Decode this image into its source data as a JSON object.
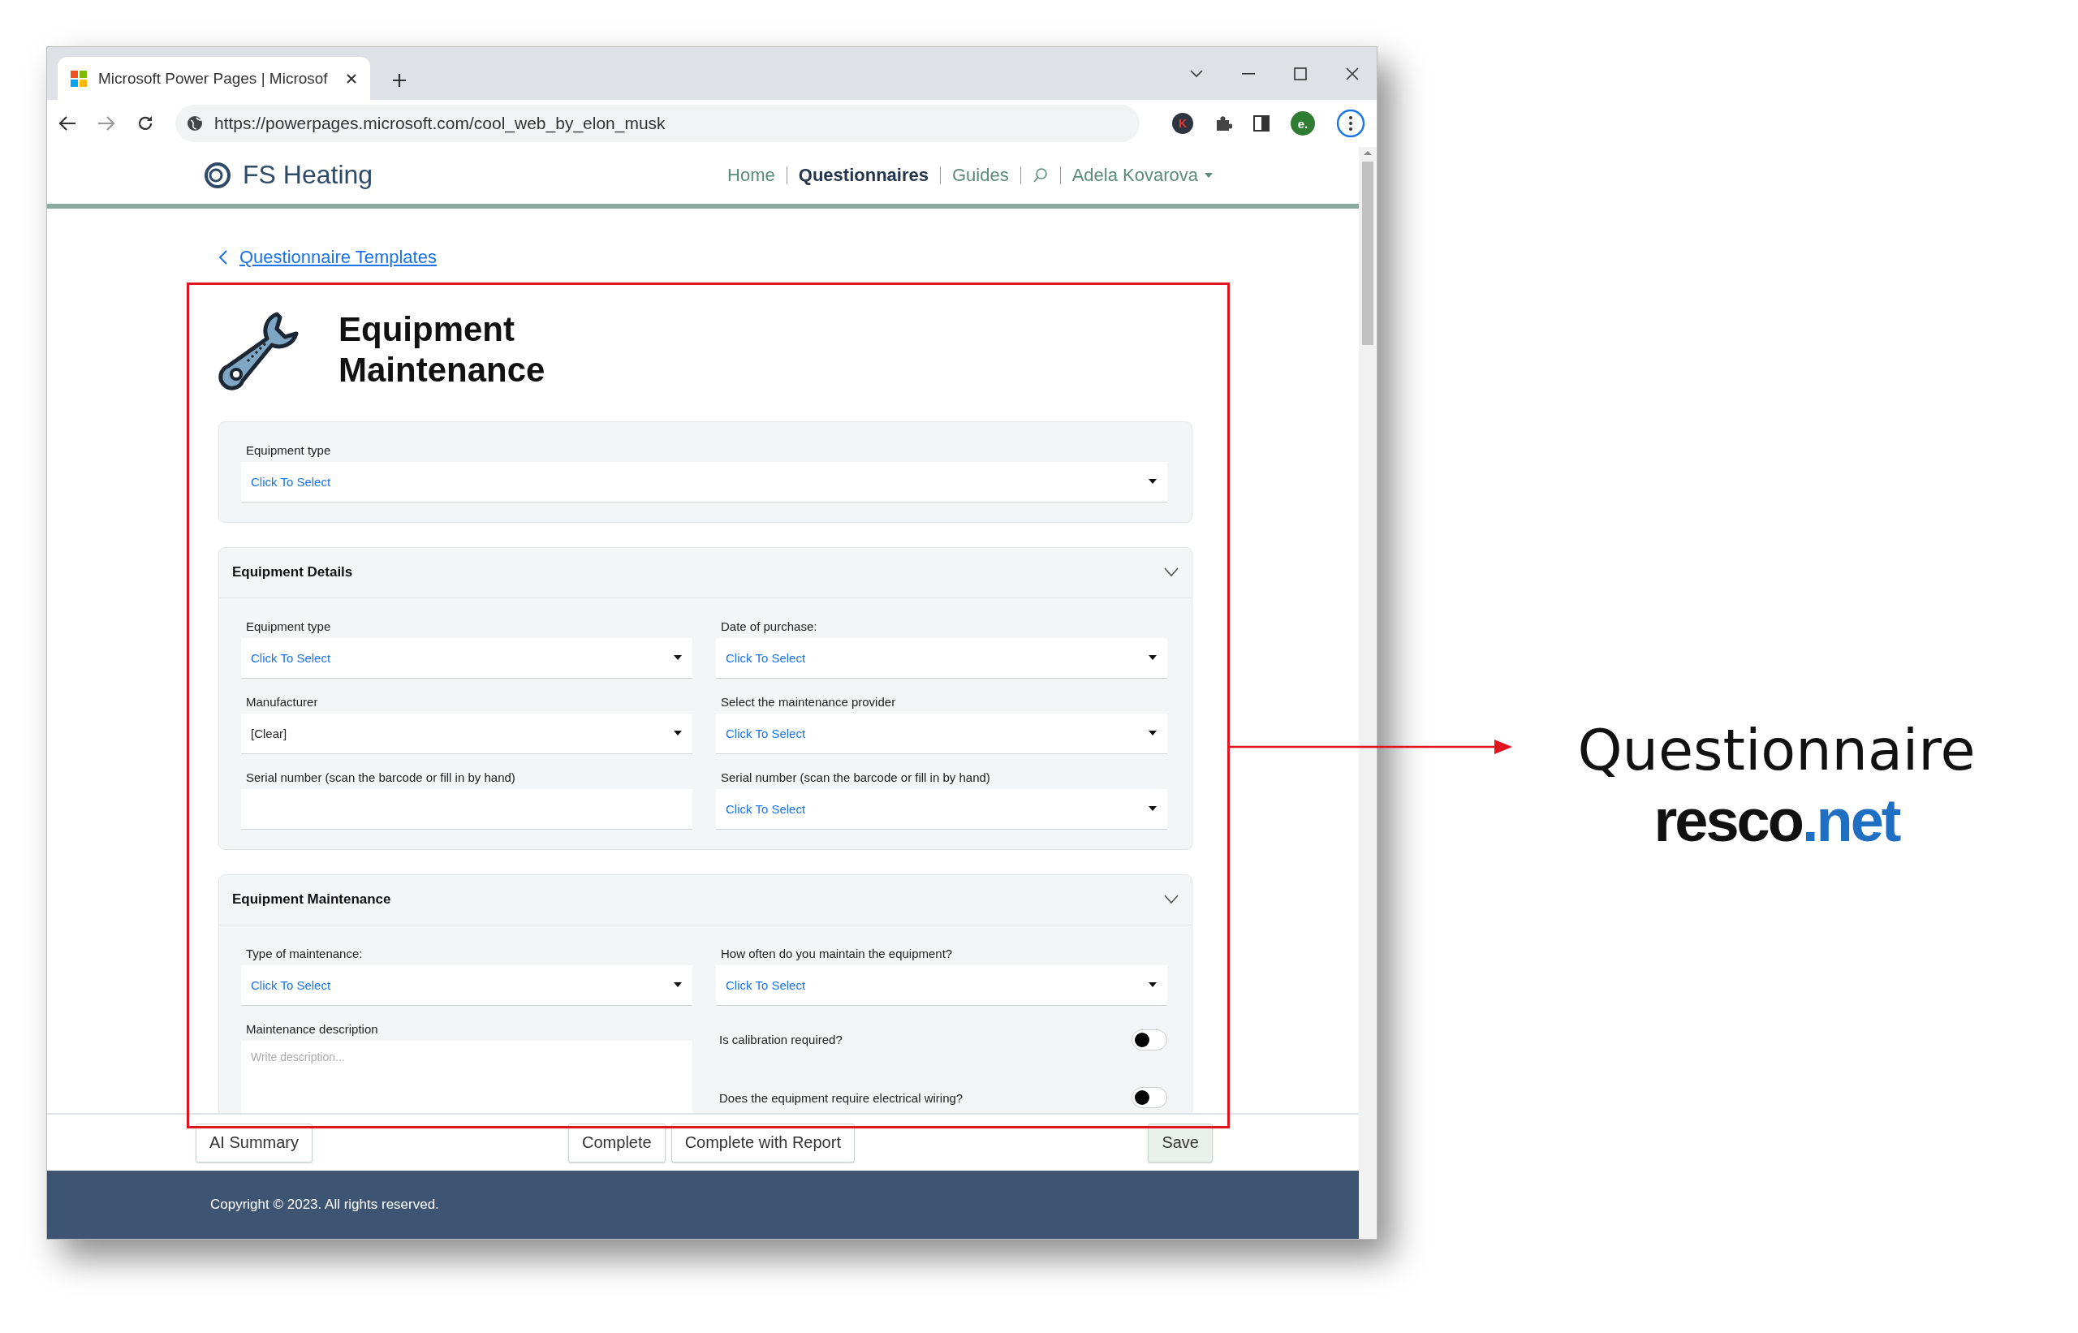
{
  "browser": {
    "tab_title": "Microsoft Power Pages | Microsof",
    "url": "https://powerpages.microsoft.com/cool_web_by_elon_musk",
    "extension_letter": "K",
    "profile_initial": "e."
  },
  "site": {
    "brand": "FS Heating",
    "nav": [
      {
        "label": "Home",
        "selected": false
      },
      {
        "label": "Questionnaires",
        "selected": true
      },
      {
        "label": "Guides",
        "selected": false
      }
    ],
    "user": "Adela Kovarova"
  },
  "back_link": "Questionnaire Templates",
  "title": "Equipment Maintenance",
  "top_field": {
    "kind": "select",
    "label": "Equipment type",
    "placeholder": "Click To Select"
  },
  "sections": [
    {
      "title": "Equipment Details",
      "expanded": true,
      "fields": [
        {
          "kind": "select",
          "label": "Equipment type",
          "placeholder": "Click To Select"
        },
        {
          "kind": "select",
          "label": "Date of purchase:",
          "placeholder": "Click To Select"
        },
        {
          "kind": "select",
          "label": "Manufacturer",
          "value": "[Clear]"
        },
        {
          "kind": "select",
          "label": "Select the maintenance provider",
          "placeholder": "Click To Select"
        },
        {
          "kind": "text",
          "label": "Serial number (scan the barcode or fill in by hand)"
        },
        {
          "kind": "select",
          "label": "Serial number (scan the barcode or fill in by hand)",
          "placeholder": "Click To Select"
        }
      ]
    },
    {
      "title": "Equipment Maintenance",
      "expanded": true,
      "fields": [
        {
          "kind": "select",
          "label": "Type of maintenance:",
          "placeholder": "Click To Select"
        },
        {
          "kind": "select",
          "label": "How often do you maintain the equipment?",
          "placeholder": "Click To Select"
        },
        {
          "kind": "textarea",
          "label": "Maintenance description",
          "placeholder": "Write description..."
        },
        {
          "kind": "toggle",
          "label": "Is calibration required?",
          "on": false
        },
        {
          "kind": "toggle",
          "label": "Does the equipment require electrical wiring?",
          "on": false
        }
      ]
    }
  ],
  "actions": {
    "left": [
      {
        "label": "AI Summary",
        "primary": false
      }
    ],
    "center": [
      {
        "label": "Complete",
        "primary": false
      },
      {
        "label": "Complete with Report",
        "primary": false
      }
    ],
    "right": [
      {
        "label": "Save",
        "primary": true
      }
    ]
  },
  "footer": "Copyright © 2023. All rights reserved.",
  "annotation": {
    "label": "Questionnaire",
    "logo": [
      {
        "text": "resco",
        "color": "#111111"
      },
      {
        "text": ".net",
        "color": "#1f6fc2"
      }
    ]
  }
}
